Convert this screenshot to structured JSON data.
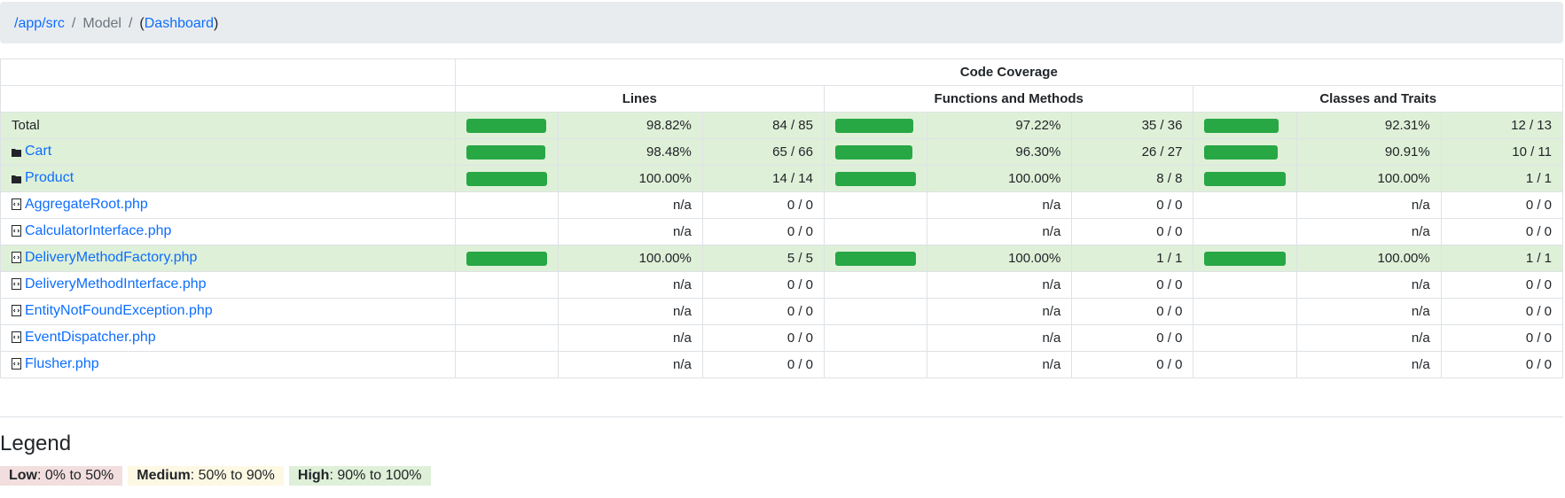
{
  "breadcrumb": {
    "root": "/app/src",
    "current": "Model",
    "dashboard": "Dashboard",
    "open": "(",
    "close": ")"
  },
  "table": {
    "title": "Code Coverage",
    "groups": [
      "Lines",
      "Functions and Methods",
      "Classes and Traits"
    ],
    "rows": [
      {
        "name": "Total",
        "kind": "total",
        "high": true,
        "lines": {
          "pct": "98.82%",
          "ratio": "84 / 85",
          "bar": 0.9882
        },
        "functions": {
          "pct": "97.22%",
          "ratio": "35 / 36",
          "bar": 0.9722
        },
        "classes": {
          "pct": "92.31%",
          "ratio": "12 / 13",
          "bar": 0.9231
        }
      },
      {
        "name": "Cart",
        "kind": "folder",
        "high": true,
        "lines": {
          "pct": "98.48%",
          "ratio": "65 / 66",
          "bar": 0.9848
        },
        "functions": {
          "pct": "96.30%",
          "ratio": "26 / 27",
          "bar": 0.963
        },
        "classes": {
          "pct": "90.91%",
          "ratio": "10 / 11",
          "bar": 0.9091
        }
      },
      {
        "name": "Product",
        "kind": "folder",
        "high": true,
        "lines": {
          "pct": "100.00%",
          "ratio": "14 / 14",
          "bar": 1.0
        },
        "functions": {
          "pct": "100.00%",
          "ratio": "8 / 8",
          "bar": 1.0
        },
        "classes": {
          "pct": "100.00%",
          "ratio": "1 / 1",
          "bar": 1.0
        }
      },
      {
        "name": "AggregateRoot.php",
        "kind": "file",
        "high": false,
        "lines": {
          "pct": "n/a",
          "ratio": "0 / 0"
        },
        "functions": {
          "pct": "n/a",
          "ratio": "0 / 0"
        },
        "classes": {
          "pct": "n/a",
          "ratio": "0 / 0"
        }
      },
      {
        "name": "CalculatorInterface.php",
        "kind": "file",
        "high": false,
        "lines": {
          "pct": "n/a",
          "ratio": "0 / 0"
        },
        "functions": {
          "pct": "n/a",
          "ratio": "0 / 0"
        },
        "classes": {
          "pct": "n/a",
          "ratio": "0 / 0"
        }
      },
      {
        "name": "DeliveryMethodFactory.php",
        "kind": "file",
        "high": true,
        "lines": {
          "pct": "100.00%",
          "ratio": "5 / 5",
          "bar": 1.0
        },
        "functions": {
          "pct": "100.00%",
          "ratio": "1 / 1",
          "bar": 1.0
        },
        "classes": {
          "pct": "100.00%",
          "ratio": "1 / 1",
          "bar": 1.0
        }
      },
      {
        "name": "DeliveryMethodInterface.php",
        "kind": "file",
        "high": false,
        "lines": {
          "pct": "n/a",
          "ratio": "0 / 0"
        },
        "functions": {
          "pct": "n/a",
          "ratio": "0 / 0"
        },
        "classes": {
          "pct": "n/a",
          "ratio": "0 / 0"
        }
      },
      {
        "name": "EntityNotFoundException.php",
        "kind": "file",
        "high": false,
        "lines": {
          "pct": "n/a",
          "ratio": "0 / 0"
        },
        "functions": {
          "pct": "n/a",
          "ratio": "0 / 0"
        },
        "classes": {
          "pct": "n/a",
          "ratio": "0 / 0"
        }
      },
      {
        "name": "EventDispatcher.php",
        "kind": "file",
        "high": false,
        "lines": {
          "pct": "n/a",
          "ratio": "0 / 0"
        },
        "functions": {
          "pct": "n/a",
          "ratio": "0 / 0"
        },
        "classes": {
          "pct": "n/a",
          "ratio": "0 / 0"
        }
      },
      {
        "name": "Flusher.php",
        "kind": "file",
        "high": false,
        "lines": {
          "pct": "n/a",
          "ratio": "0 / 0"
        },
        "functions": {
          "pct": "n/a",
          "ratio": "0 / 0"
        },
        "classes": {
          "pct": "n/a",
          "ratio": "0 / 0"
        }
      }
    ]
  },
  "legend": {
    "title": "Legend",
    "low": {
      "label": "Low",
      "range": ": 0% to 50%"
    },
    "medium": {
      "label": "Medium",
      "range": ": 50% to 90%"
    },
    "high": {
      "label": "High",
      "range": ": 90% to 100%"
    }
  },
  "colors": {
    "high_bg": "#dff0d8",
    "bar": "#28a745",
    "link": "#0d6efd"
  },
  "icons": {
    "folder": "folder-icon",
    "file": "php-file-icon"
  }
}
